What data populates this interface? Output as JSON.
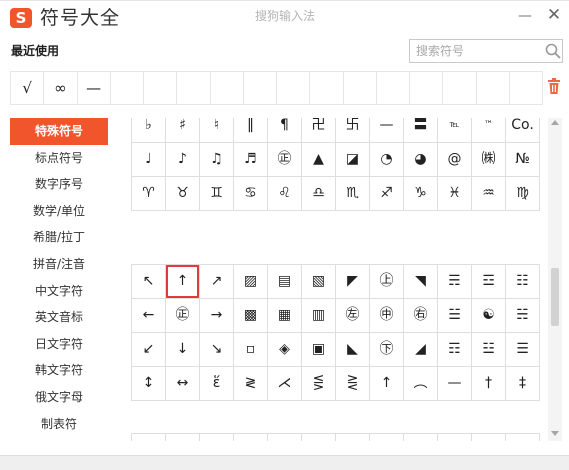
{
  "window": {
    "logo_letter": "S",
    "app_title": "符号大全",
    "title": "搜狗输入法",
    "minimize_glyph": "—",
    "close_glyph": "✕",
    "accent_color": "#f0552b"
  },
  "recent": {
    "label": "最近使用",
    "symbols": [
      "√",
      "∞",
      "—",
      "",
      "",
      "",
      "",
      "",
      "",
      "",
      "",
      "",
      "",
      "",
      "",
      ""
    ]
  },
  "search": {
    "placeholder": "搜索符号",
    "icon": "search-icon"
  },
  "trash_icon": "trash-icon",
  "sidebar": {
    "items": [
      {
        "label": "特殊符号",
        "active": true
      },
      {
        "label": "标点符号",
        "active": false
      },
      {
        "label": "数字序号",
        "active": false
      },
      {
        "label": "数学/单位",
        "active": false
      },
      {
        "label": "希腊/拉丁",
        "active": false
      },
      {
        "label": "拼音/注音",
        "active": false
      },
      {
        "label": "中文字符",
        "active": false
      },
      {
        "label": "英文音标",
        "active": false
      },
      {
        "label": "日文字符",
        "active": false
      },
      {
        "label": "韩文字符",
        "active": false
      },
      {
        "label": "俄文字母",
        "active": false
      },
      {
        "label": "制表符",
        "active": false
      }
    ]
  },
  "grid_top": [
    [
      "♭",
      "♯",
      "♮",
      "‖",
      "¶",
      "卍",
      "卐",
      "—",
      "〓",
      "℡",
      "™",
      "Co."
    ],
    [
      "♩",
      "♪",
      "♫",
      "♬",
      "㊣",
      "▲",
      "◪",
      "◔",
      "◕",
      "@",
      "㈱",
      "№"
    ],
    [
      "♈",
      "♉",
      "♊",
      "♋",
      "♌",
      "♎",
      "♏",
      "♐",
      "♑",
      "♓",
      "♒",
      "♍"
    ]
  ],
  "grid_main": [
    [
      "↖",
      "↑",
      "↗",
      "▨",
      "▤",
      "▧",
      "◤",
      "㊤",
      "◥",
      "☴",
      "☲",
      "☷"
    ],
    [
      "←",
      "㊣",
      "→",
      "▩",
      "▦",
      "▥",
      "㊧",
      "㊥",
      "㊨",
      "☱",
      "☯",
      "☵"
    ],
    [
      "↙",
      "↓",
      "↘",
      "▫",
      "◈",
      "▣",
      "◣",
      "㊦",
      "◢",
      "☶",
      "☳",
      "☰"
    ],
    [
      "↕",
      "↔",
      "ἕ",
      "≷",
      "⋌",
      "⋚",
      "⋛",
      "↑",
      "︵",
      "—",
      "†",
      "‡"
    ]
  ],
  "selected_symbol": "↑"
}
